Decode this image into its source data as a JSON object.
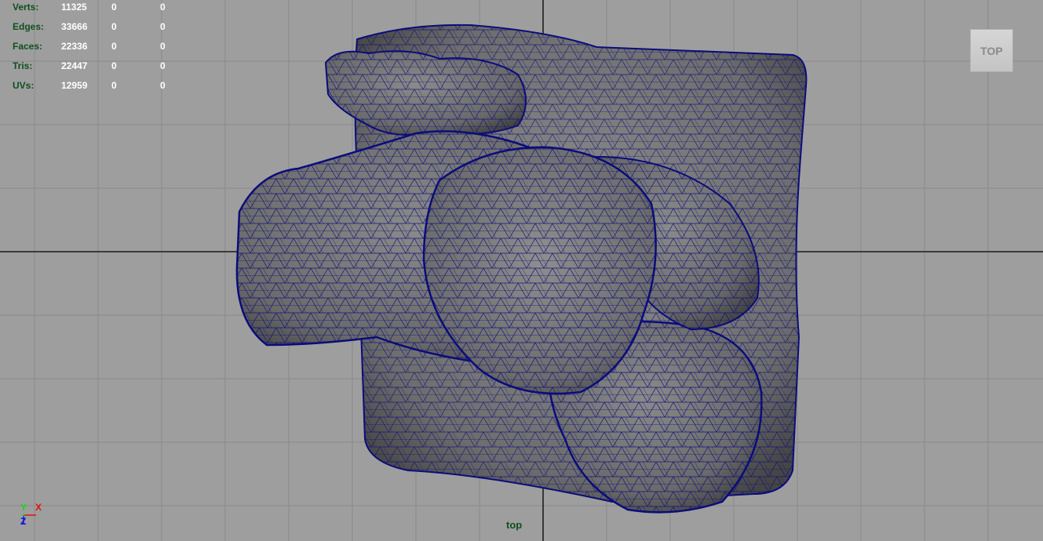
{
  "hud": {
    "rows": [
      {
        "label": "Verts:",
        "v1": "11325",
        "v2": "0",
        "v3": "0"
      },
      {
        "label": "Edges:",
        "v1": "33666",
        "v2": "0",
        "v3": "0"
      },
      {
        "label": "Faces:",
        "v1": "22336",
        "v2": "0",
        "v3": "0"
      },
      {
        "label": "Tris:",
        "v1": "22447",
        "v2": "0",
        "v3": "0"
      },
      {
        "label": "UVs:",
        "v1": "12959",
        "v2": "0",
        "v3": "0"
      }
    ]
  },
  "view_cube": {
    "label": "TOP"
  },
  "camera": {
    "name": "top"
  },
  "axis_gizmo": {
    "x_label": "X",
    "y_label": "Y",
    "z_label": "Z"
  },
  "colors": {
    "viewport_bg": "#9e9e9e",
    "grid_line": "#8a8a8a",
    "grid_axis": "#000000",
    "wire": "#0b0c7a",
    "shade": "#707070",
    "hud_label": "#0f4f1e",
    "hud_value": "#ffffff",
    "axis_x": "#e01010",
    "axis_y": "#20d020",
    "axis_z": "#1010e0"
  }
}
